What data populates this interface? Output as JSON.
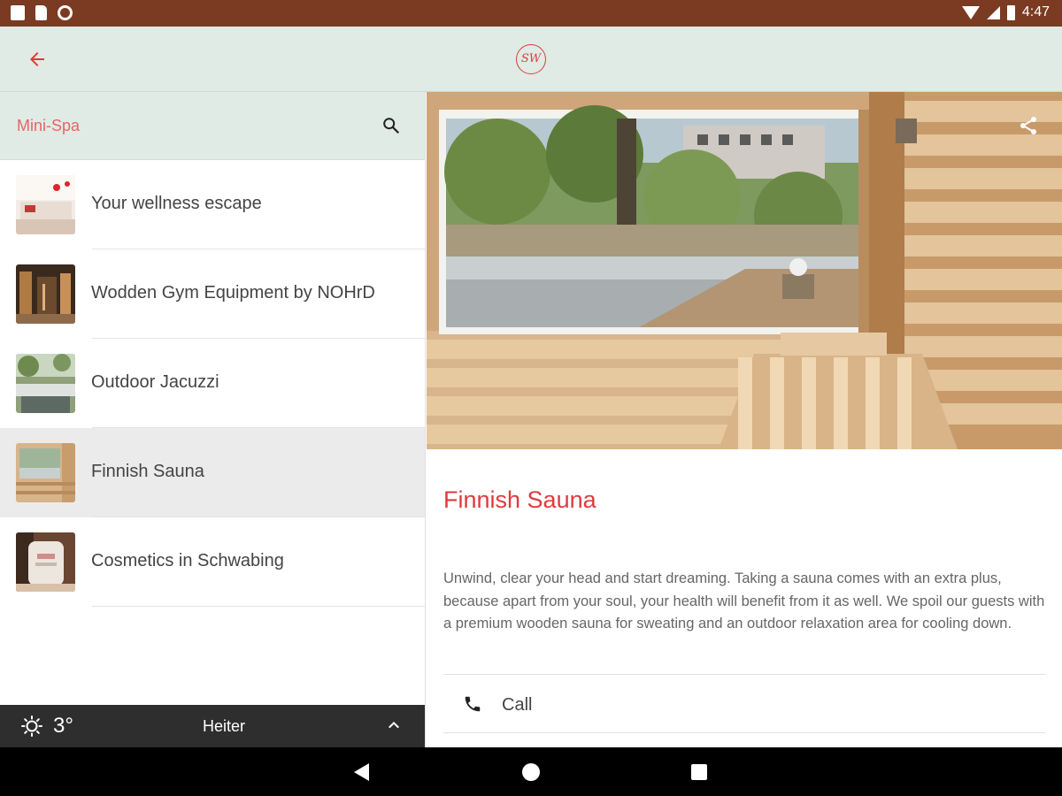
{
  "status_bar": {
    "time": "4:47",
    "icons": [
      "notification-a-icon",
      "sd-card-icon",
      "sync-circle-icon",
      "wifi-icon",
      "cell-signal-icon",
      "battery-icon"
    ]
  },
  "app_bar": {
    "back_icon": "arrow-left-icon",
    "logo_text": "SW",
    "accent_color": "#e03a3e"
  },
  "search": {
    "label": "Mini-Spa",
    "icon": "search-icon"
  },
  "list": {
    "items": [
      {
        "label": "Your wellness escape",
        "selected": false
      },
      {
        "label": "Wodden Gym Equipment by NOHrD",
        "selected": false
      },
      {
        "label": "Outdoor Jacuzzi",
        "selected": false
      },
      {
        "label": "Finnish Sauna",
        "selected": true
      },
      {
        "label": "Cosmetics in Schwabing",
        "selected": false
      }
    ]
  },
  "weather": {
    "temperature": "3°",
    "condition": "Heiter",
    "icon": "sun-icon"
  },
  "detail": {
    "title": "Finnish Sauna",
    "description": "Unwind, clear your head and start dreaming. Taking a sauna comes with an extra plus, because apart from your soul, your health will benefit from it as well. We spoil our guests with a premium wooden sauna for sweating and an outdoor relaxation area for cooling down.",
    "call_label": "Call"
  },
  "colors": {
    "status_bar": "#7b3a22",
    "app_bar": "#dfebe4",
    "accent": "#e03a3e",
    "weather_bar": "#2e2e2e"
  }
}
